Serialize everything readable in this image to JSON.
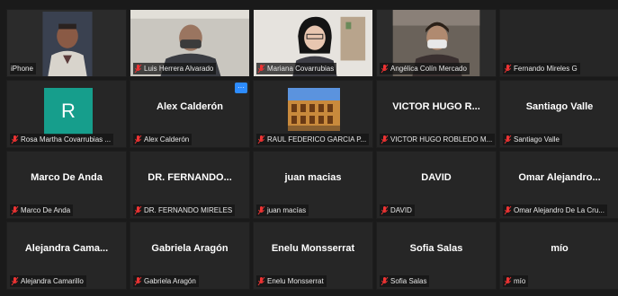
{
  "participants": [
    {
      "display": "video",
      "label": "iPhone",
      "muted": false,
      "icon": "person-video-1"
    },
    {
      "display": "video",
      "label": "Luis Herrera Alvarado",
      "muted": true,
      "icon": "person-video-2"
    },
    {
      "display": "video",
      "label": "Mariana Covarrubias",
      "muted": true,
      "icon": "person-video-3"
    },
    {
      "display": "video",
      "label": "Angélica Colín Mercado",
      "muted": true,
      "icon": "person-video-4"
    },
    {
      "display": "name",
      "name": "",
      "label": "Fernando Mireles G",
      "muted": true
    },
    {
      "display": "avatar",
      "initial": "R",
      "label": "Rosa Martha Covarrubias ...",
      "muted": true
    },
    {
      "display": "name",
      "name": "Alex Calderón",
      "label": "Alex Calderón",
      "muted": true,
      "more_button": "···"
    },
    {
      "display": "picture",
      "label": "RAUL FEDERICO GARCIA P...",
      "muted": true,
      "icon": "colosseum-picture"
    },
    {
      "display": "name",
      "name": "VICTOR HUGO R...",
      "label": "VICTOR HUGO ROBLEDO M...",
      "muted": true
    },
    {
      "display": "name",
      "name": "Santiago Valle",
      "label": "Santiago Valle",
      "muted": true
    },
    {
      "display": "name",
      "name": "Marco De Anda",
      "label": "Marco De Anda",
      "muted": true
    },
    {
      "display": "name",
      "name": "DR. FERNANDO...",
      "label": "DR. FERNANDO MIRELES",
      "muted": true
    },
    {
      "display": "name",
      "name": "juan macias",
      "label": "juan macías",
      "muted": true
    },
    {
      "display": "name",
      "name": "DAVID",
      "label": "DAVID",
      "muted": true
    },
    {
      "display": "name",
      "name": "Omar Alejandro...",
      "label": "Omar Alejandro De La Cru...",
      "muted": true
    },
    {
      "display": "name",
      "name": "Alejandra Cama...",
      "label": "Alejandra Camarillo",
      "muted": true
    },
    {
      "display": "name",
      "name": "Gabriela Aragón",
      "label": "Gabriela Aragón",
      "muted": true
    },
    {
      "display": "name",
      "name": "Enelu Monsserrat",
      "label": "Enelu Monsserrat",
      "muted": true
    },
    {
      "display": "name",
      "name": "Sofia Salas",
      "label": "Sofia Salas",
      "muted": true
    },
    {
      "display": "name",
      "name": "mío",
      "label": "mío",
      "muted": true
    }
  ]
}
